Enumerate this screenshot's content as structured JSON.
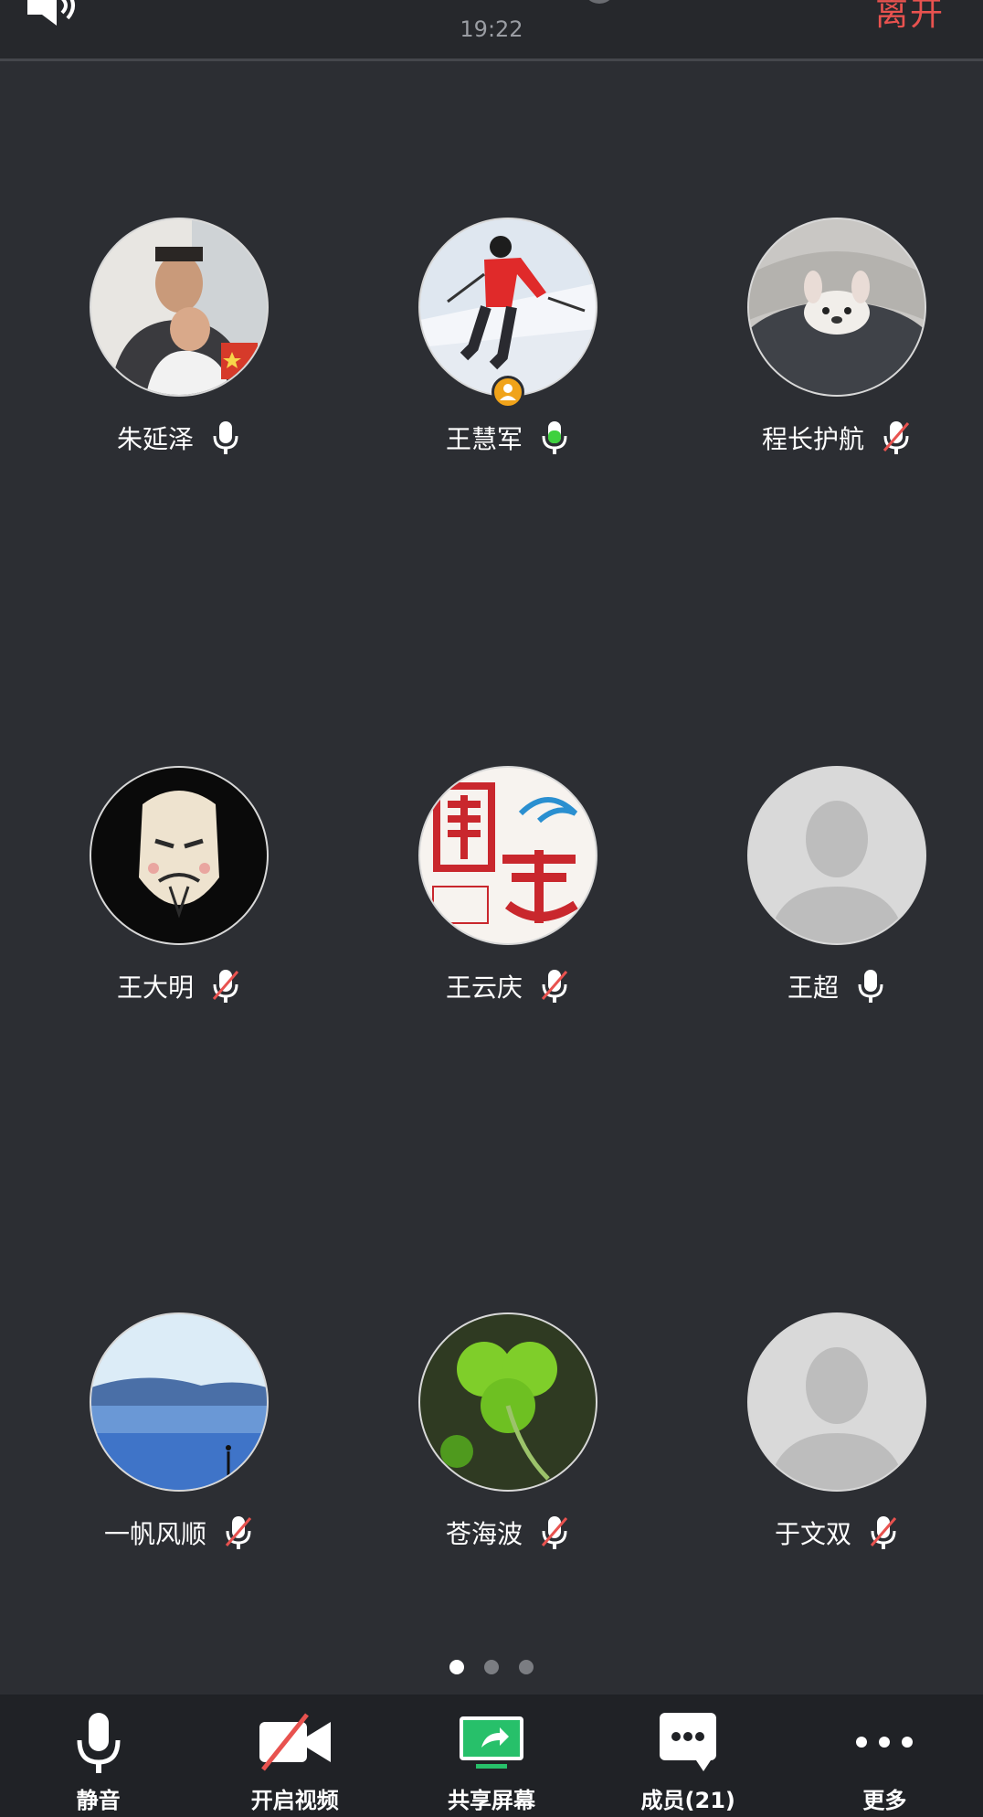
{
  "status_bar": {
    "time": "19:22",
    "leave_label": "离开"
  },
  "participants": [
    {
      "name": "朱延泽",
      "mic": "on"
    },
    {
      "name": "王慧军",
      "mic": "speaking",
      "host": true
    },
    {
      "name": "程长护航",
      "mic": "muted"
    },
    {
      "name": "王大明",
      "mic": "muted"
    },
    {
      "name": "王云庆",
      "mic": "muted"
    },
    {
      "name": "王超",
      "mic": "on"
    },
    {
      "name": "一帆风顺",
      "mic": "muted"
    },
    {
      "name": "苍海波",
      "mic": "muted"
    },
    {
      "name": "于文双",
      "mic": "muted"
    }
  ],
  "pagination": {
    "pages": 3,
    "current": 1
  },
  "toolbar": {
    "mute_label": "静音",
    "video_label": "开启视频",
    "share_label": "共享屏幕",
    "members_label": "成员(21)",
    "more_label": "更多"
  },
  "colors": {
    "background": "#2c2e33",
    "leave": "#e8524f",
    "speaking": "#3fd13f",
    "muted_slash": "#e8524f",
    "host_badge": "#f0a31a",
    "share_green": "#27c06a"
  }
}
